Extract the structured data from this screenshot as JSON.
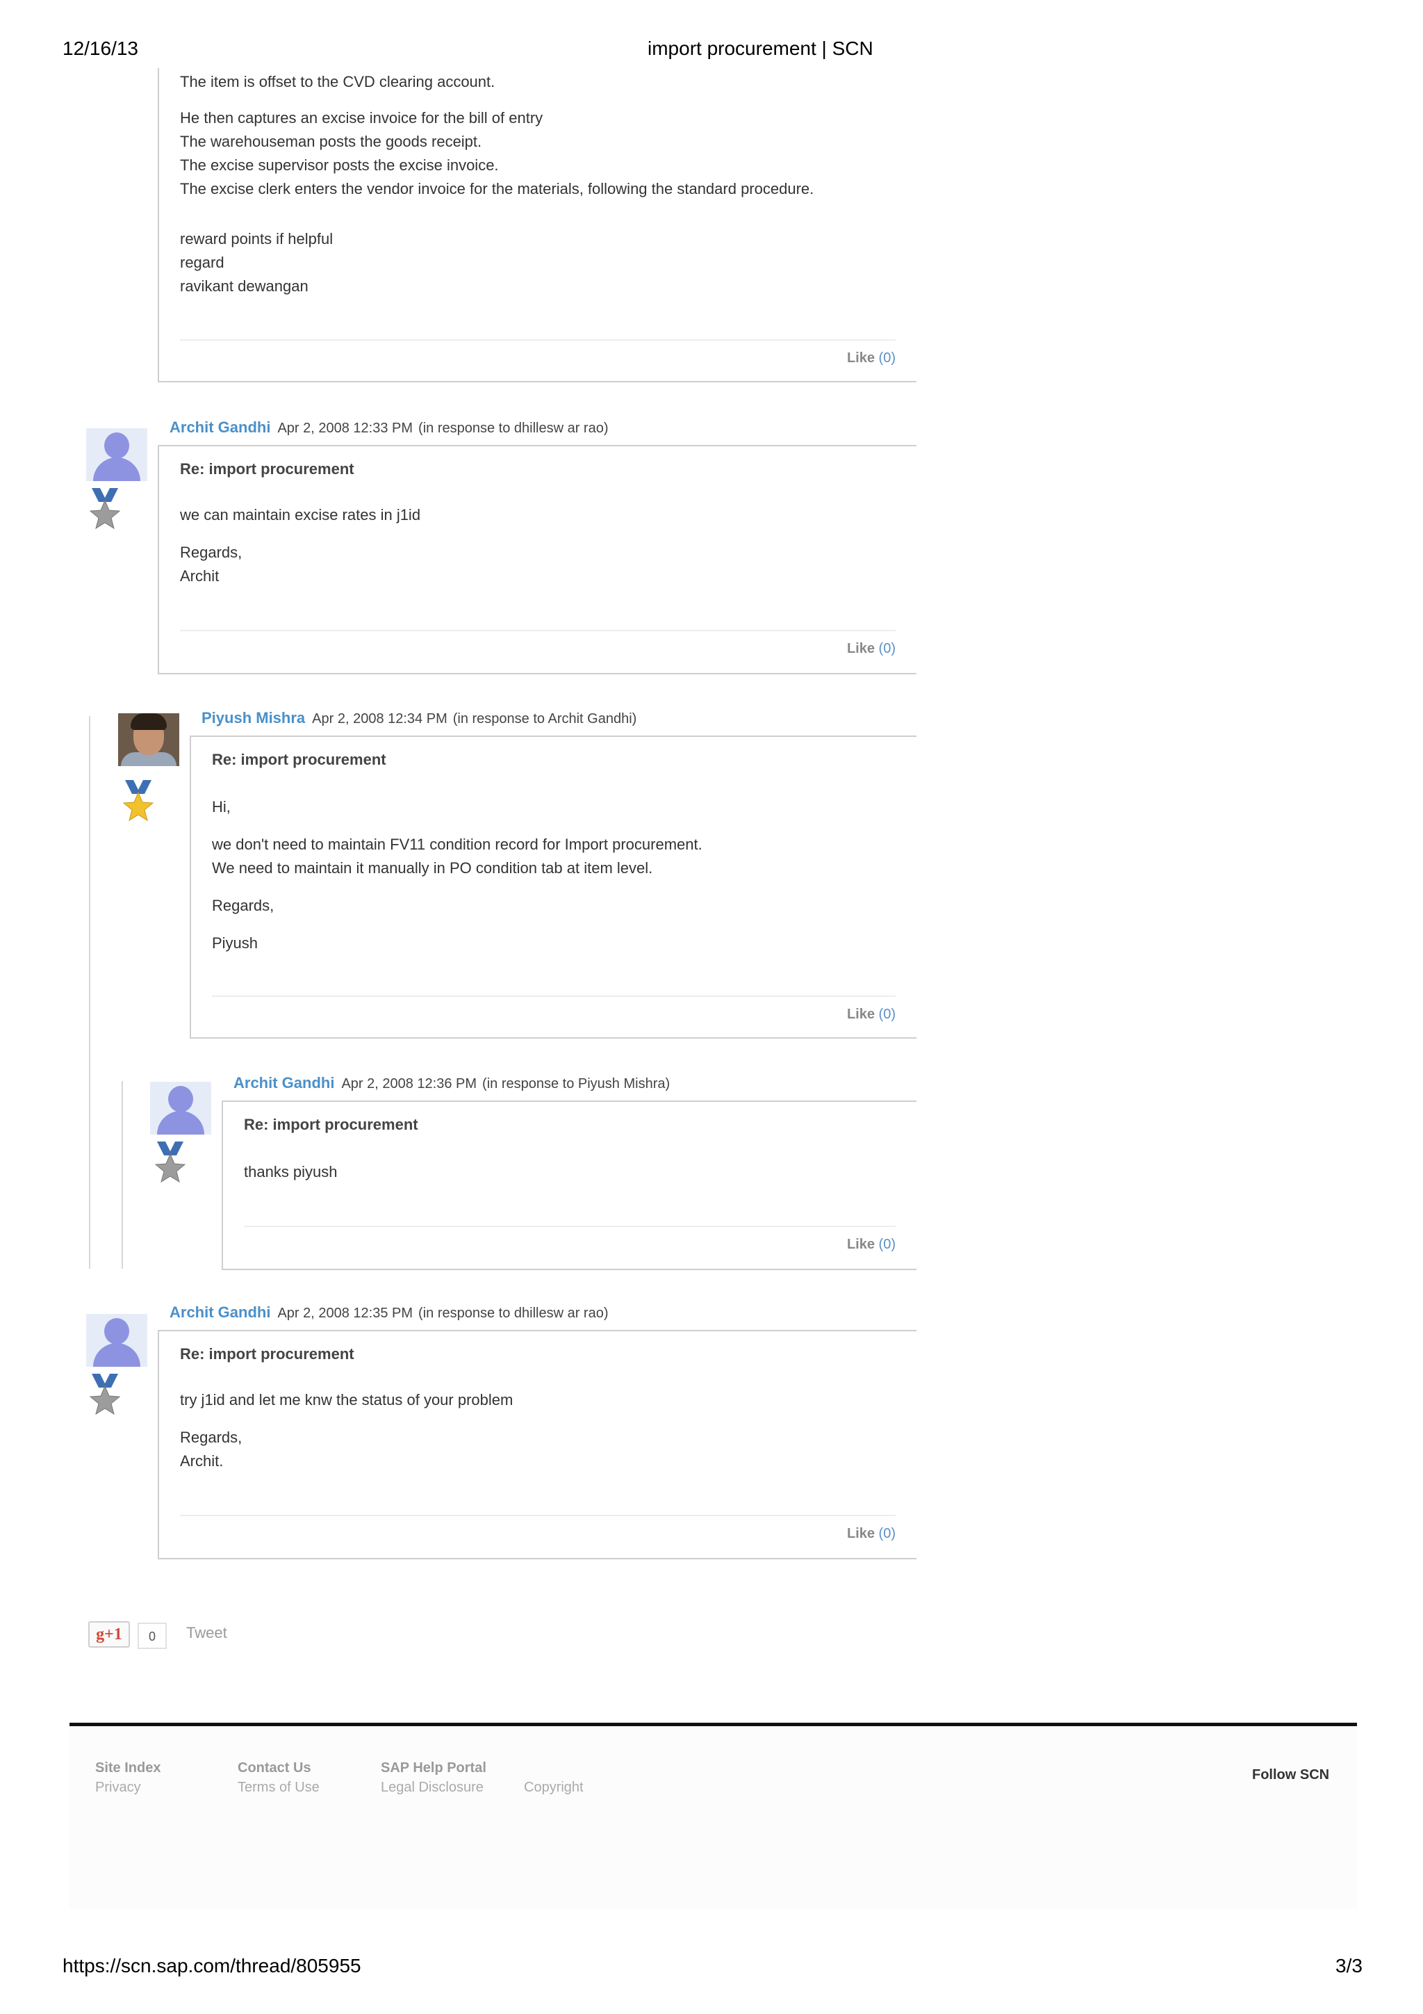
{
  "header": {
    "date": "12/16/13",
    "title": "import procurement | SCN"
  },
  "footer_print": {
    "url": "https://scn.sap.com/thread/805955",
    "page": "3/3"
  },
  "top_card": {
    "lines": [
      "The item is offset to the CVD clearing account.",
      "He then captures an excise invoice for the bill of entry",
      "The warehouseman posts the goods receipt.",
      "The excise supervisor posts the excise invoice.",
      "The excise clerk enters the vendor invoice for the materials, following the standard procedure.",
      "reward points if helpful",
      "regard",
      "ravikant dewangan"
    ],
    "like_label": "Like",
    "like_count": "(0)"
  },
  "replies": [
    {
      "author": "Archit Gandhi",
      "date": "Apr 2, 2008 12:33 PM",
      "in_response": "(in response to dhillesw ar rao)",
      "subject": "Re: import procurement",
      "lines": [
        "we can maintain excise rates in j1id",
        "Regards,",
        "Archit"
      ],
      "like_label": "Like",
      "like_count": "(0)"
    },
    {
      "author": "Piyush Mishra",
      "date": "Apr 2, 2008 12:34 PM",
      "in_response": "(in response to Archit Gandhi)",
      "subject": "Re: import procurement",
      "lines": [
        "Hi,",
        "we don't need to maintain FV11 condition record for Import procurement.",
        "We need to maintain it manually in PO condition tab at item level.",
        "Regards,",
        "Piyush"
      ],
      "like_label": "Like",
      "like_count": "(0)"
    },
    {
      "author": "Archit Gandhi",
      "date": "Apr 2, 2008 12:36 PM",
      "in_response": "(in response to Piyush Mishra)",
      "subject": "Re: import procurement",
      "lines": [
        "thanks piyush"
      ],
      "like_label": "Like",
      "like_count": "(0)"
    },
    {
      "author": "Archit Gandhi",
      "date": "Apr 2, 2008 12:35 PM",
      "in_response": "(in response to dhillesw ar rao)",
      "subject": "Re: import procurement",
      "lines": [
        "try j1id and let me knw the status of your problem",
        "Regards,",
        "Archit."
      ],
      "like_label": "Like",
      "like_count": "(0)"
    }
  ],
  "share": {
    "gplus_label": "g+1",
    "gplus_count": "0",
    "tweet_label": "Tweet"
  },
  "site_footer": {
    "site_index": "Site Index",
    "privacy": "Privacy",
    "contact_us": "Contact Us",
    "terms": "Terms of Use",
    "help_portal": "SAP Help Portal",
    "legal": "Legal Disclosure",
    "copyright": "Copyright",
    "follow": "Follow SCN"
  },
  "colors": {
    "author_link": "#4a90c9",
    "like_count": "#5a8fc7",
    "badge_blue": "#3f6fb3",
    "badge_gold": "#f2c12e",
    "badge_silver": "#9c9c9c"
  }
}
